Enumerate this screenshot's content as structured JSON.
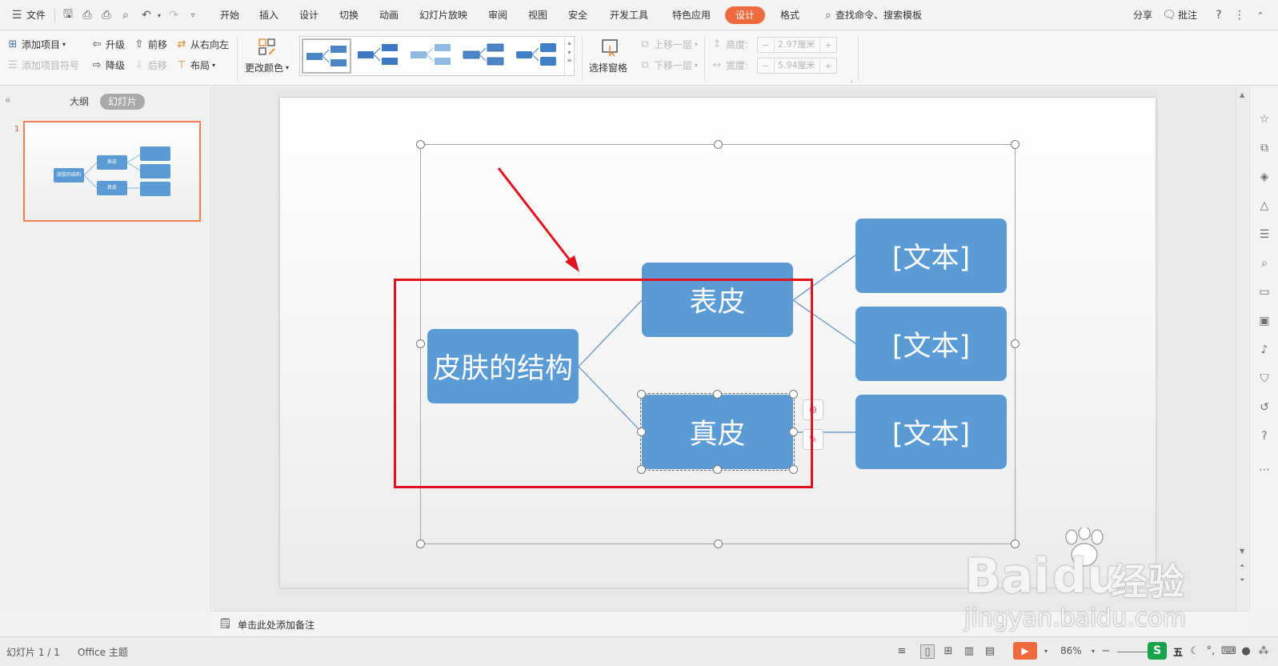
{
  "menubar": {
    "file_label": "文件",
    "tabs": [
      "开始",
      "插入",
      "设计",
      "切换",
      "动画",
      "幻灯片放映",
      "审阅",
      "视图",
      "安全",
      "开发工具",
      "特色应用"
    ],
    "active_tab": "设计",
    "format_tab": "格式",
    "search_label": "查找命令、搜索模板",
    "share_label": "分享",
    "comment_label": "批注",
    "accent_color": "#ef6a3c"
  },
  "ribbon": {
    "add_item": "添加项目",
    "add_item_symbol": "添加项目符号",
    "promote": "升级",
    "demote": "降级",
    "move_forward": "前移",
    "move_backward": "后移",
    "right_to_left": "从右向左",
    "layout": "布局",
    "change_color": "更改颜色",
    "selection_pane": "选择窗格",
    "bring_forward": "上移一层",
    "send_backward": "下移一层",
    "height_label": "高度:",
    "height_value": "2.97厘米",
    "width_label": "宽度:",
    "width_value": "5.94厘米"
  },
  "left_panel": {
    "tab_outline": "大纲",
    "tab_slides": "幻灯片",
    "slide_number": "1",
    "thumb_root": "皮肤的结构",
    "thumb_child1": "表皮",
    "thumb_child2": "真皮"
  },
  "slide": {
    "root": "皮肤的结构",
    "child1": "表皮",
    "child2": "真皮",
    "leaves": [
      "[文本]",
      "[文本]",
      "[文本]"
    ],
    "box_color": "#5b9bd5",
    "highlight_color": "#e0141e"
  },
  "notes": {
    "placeholder": "单击此处添加备注"
  },
  "status": {
    "slide_info": "幻灯片 1 / 1",
    "theme": "Office 主题",
    "zoom": "86%",
    "ime_label": "五"
  },
  "watermark": {
    "brand": "Bai",
    "brand_tail": "du",
    "product": "经验",
    "url": "jingyan.baidu.com"
  }
}
